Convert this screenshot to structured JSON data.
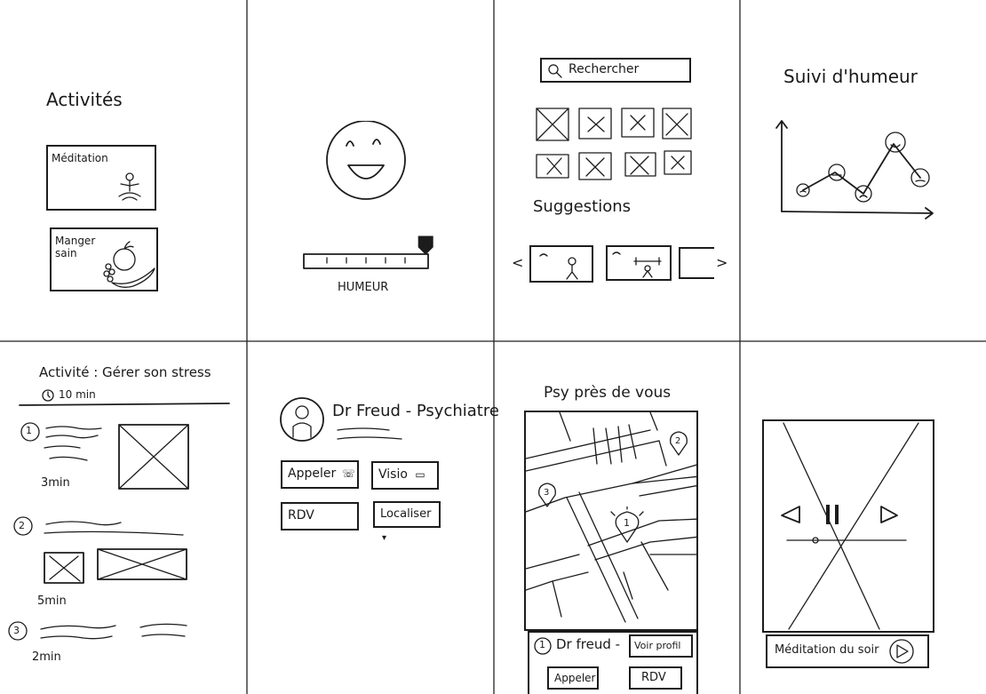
{
  "activities_screen": {
    "title": "Activités",
    "cards": [
      {
        "label": "Méditation"
      },
      {
        "label": "Manger sain"
      }
    ]
  },
  "mood_screen": {
    "slider_label": "HUMEUR",
    "mood_level": 0.98
  },
  "search_screen": {
    "search_placeholder": "Rechercher",
    "suggestions_title": "Suggestions",
    "prev_arrow": "<",
    "next_arrow": ">"
  },
  "mood_tracking_screen": {
    "title": "Suivi d'humeur"
  },
  "activity_detail_screen": {
    "title": "Activité : Gérer son stress",
    "duration": "10 min",
    "steps": [
      {
        "number": "1",
        "duration": "3min"
      },
      {
        "number": "2",
        "duration": "5min"
      },
      {
        "number": "3",
        "duration": "2min"
      }
    ]
  },
  "doctor_screen": {
    "name": "Dr Freud - Psychiatre",
    "buttons": {
      "call": "Appeler",
      "visio": "Visio",
      "rdv": "RDV",
      "locate": "Localiser"
    }
  },
  "map_screen": {
    "title": "Psy près de vous",
    "markers": [
      "1",
      "2",
      "3"
    ],
    "result_number": "1",
    "result_name": "Dr freud -",
    "view_profile": "Voir profil",
    "call": "Appeler",
    "rdv": "RDV"
  },
  "player_screen": {
    "track_title": "Méditation du soir",
    "prev_icon": "prev-triangle-icon",
    "pause_icon": "pause-icon",
    "next_icon": "next-triangle-icon"
  }
}
